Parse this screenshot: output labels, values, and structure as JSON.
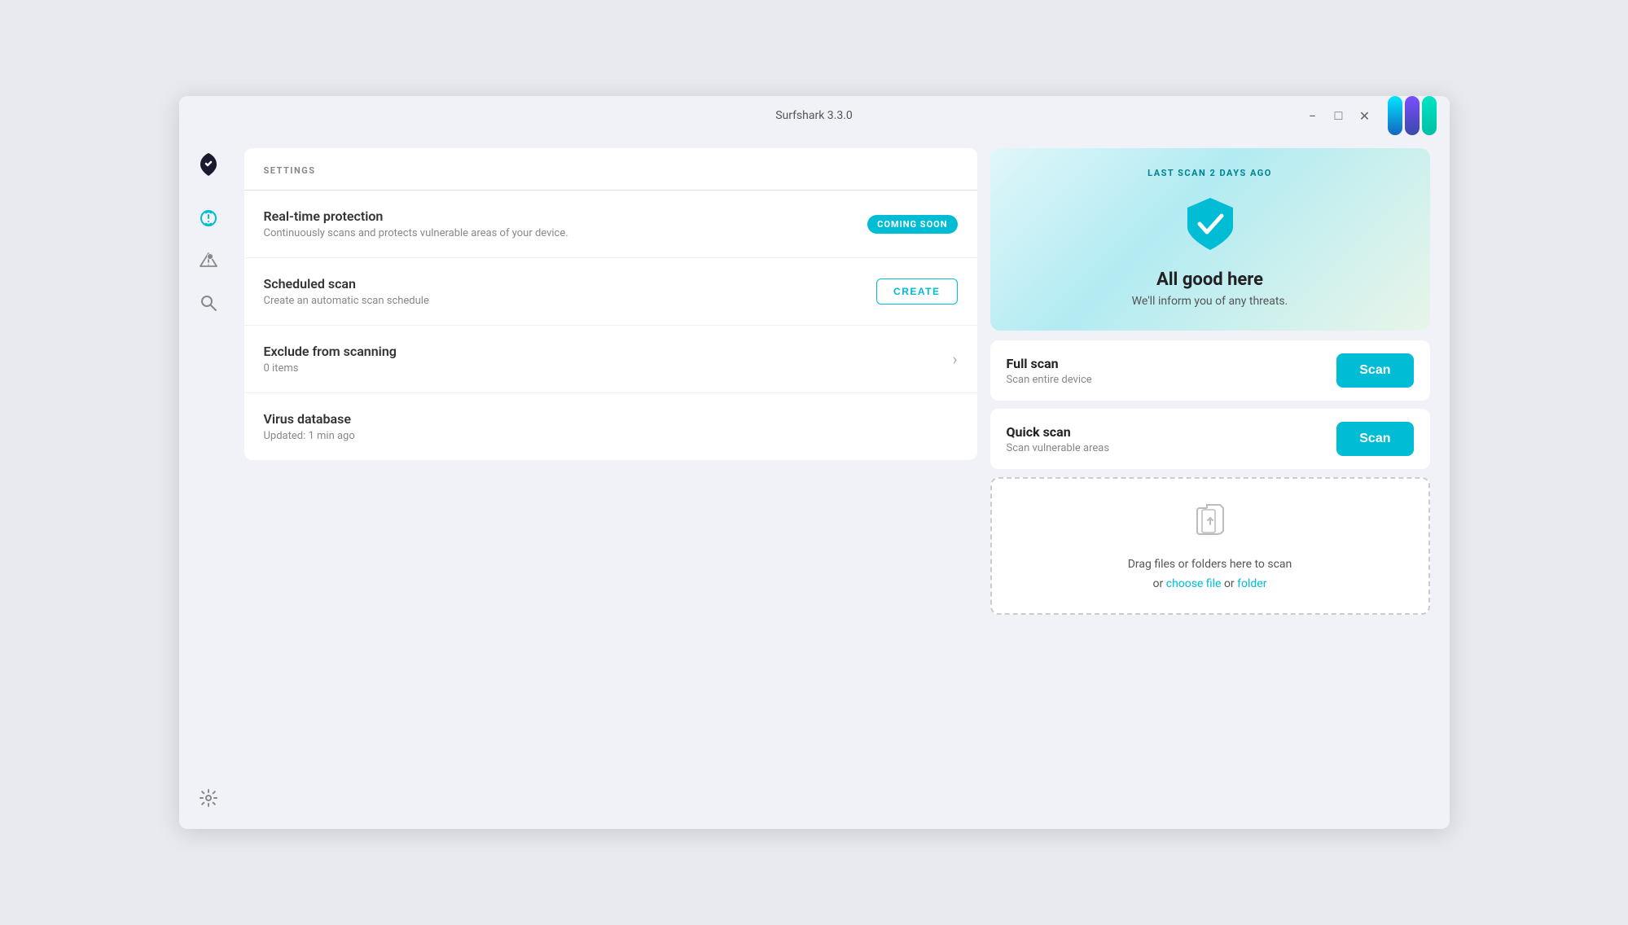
{
  "window": {
    "title": "Surfshark 3.3.0",
    "controls": {
      "minimize": "−",
      "maximize": "□",
      "close": "✕"
    }
  },
  "sidebar": {
    "items": [
      {
        "name": "logo",
        "icon": "🦈"
      },
      {
        "name": "bug-scan",
        "icon": "🐛"
      },
      {
        "name": "alert-bug",
        "icon": "⚠"
      },
      {
        "name": "search-scan",
        "icon": "🔍"
      }
    ],
    "bottom": [
      {
        "name": "settings",
        "icon": "⚙"
      }
    ]
  },
  "settings": {
    "header": "SETTINGS",
    "cards": [
      {
        "title": "Real-time protection",
        "subtitle": "Continuously scans and protects vulnerable areas of your device.",
        "badge": "COMING SOON"
      },
      {
        "title": "Scheduled scan",
        "subtitle": "Create an automatic scan schedule",
        "button": "CREATE"
      },
      {
        "title": "Exclude from scanning",
        "subtitle": "0 items",
        "arrow": true
      },
      {
        "title": "Virus database",
        "subtitle": "Updated: 1 min ago"
      }
    ]
  },
  "status": {
    "last_scan": "LAST SCAN 2 DAYS AGO",
    "title": "All good here",
    "subtitle": "We'll inform you of any threats."
  },
  "scan_options": [
    {
      "title": "Full scan",
      "subtitle": "Scan entire device",
      "button": "Scan"
    },
    {
      "title": "Quick scan",
      "subtitle": "Scan vulnerable areas",
      "button": "Scan"
    }
  ],
  "drag_drop": {
    "text": "Drag files or folders here to scan",
    "or_text": "or",
    "choose_file": "choose file",
    "or_text2": "or",
    "folder": "folder"
  }
}
